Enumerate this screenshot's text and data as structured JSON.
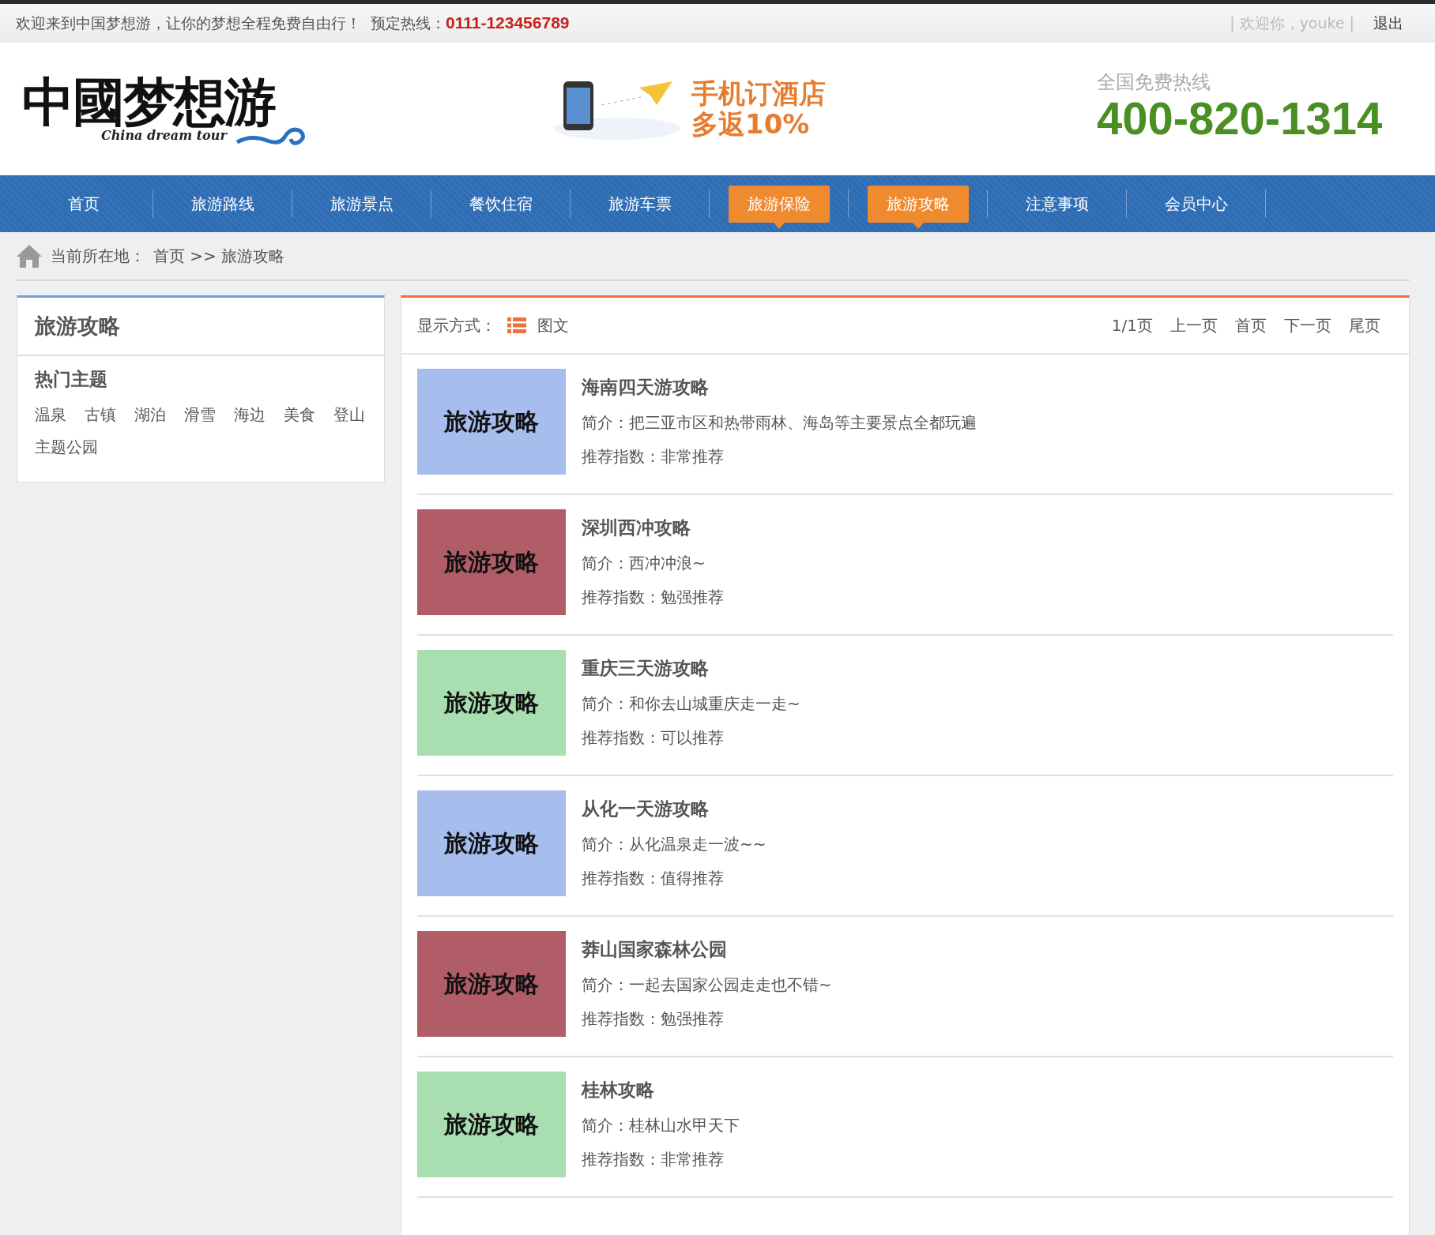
{
  "top_bar": {
    "welcome": "欢迎来到中国梦想游，让你的梦想全程免费自由行！",
    "hotline_label": "预定热线：",
    "hotline": "0111-123456789",
    "user_greeting": "| 欢迎你，youke |",
    "logout": "退出"
  },
  "header": {
    "logo_text": "中國梦想游",
    "logo_subtitle": "China dream tour",
    "promo_line_1": "手机订酒店",
    "promo_line_2": "多返10%",
    "phone_label": "全国免费热线",
    "phone": "400-820-1314"
  },
  "nav": [
    {
      "label": "首页",
      "selected": false
    },
    {
      "label": "旅游路线",
      "selected": false
    },
    {
      "label": "旅游景点",
      "selected": false
    },
    {
      "label": "餐饮住宿",
      "selected": false
    },
    {
      "label": "旅游车票",
      "selected": false
    },
    {
      "label": "旅游保险",
      "selected": true
    },
    {
      "label": "旅游攻略",
      "selected": true
    },
    {
      "label": "注意事项",
      "selected": false
    },
    {
      "label": "会员中心",
      "selected": false
    }
  ],
  "breadcrumb": {
    "label": "当前所在地：",
    "path": "首页 >> 旅游攻略"
  },
  "sidebar": {
    "title": "旅游攻略",
    "section_title": "热门主题",
    "tags": [
      "温泉",
      "古镇",
      "湖泊",
      "滑雪",
      "海边",
      "美食",
      "登山",
      "主题公园"
    ]
  },
  "toolbar": {
    "display_label": "显示方式：",
    "display_mode": "图文",
    "page_info": "1/1页",
    "pager": [
      "上一页",
      "首页",
      "下一页",
      "尾页"
    ]
  },
  "articles": [
    {
      "thumb_text": "旅游攻略",
      "color": "#a6bdee",
      "title": "海南四天游攻略",
      "summary": "简介：把三亚市区和热带雨林、海岛等主要景点全都玩遍",
      "rating": "推荐指数：非常推荐"
    },
    {
      "thumb_text": "旅游攻略",
      "color": "#b05d68",
      "title": "深圳西冲攻略",
      "summary": "简介：西冲冲浪~",
      "rating": "推荐指数：勉强推荐"
    },
    {
      "thumb_text": "旅游攻略",
      "color": "#a8deb0",
      "title": "重庆三天游攻略",
      "summary": "简介：和你去山城重庆走一走~",
      "rating": "推荐指数：可以推荐"
    },
    {
      "thumb_text": "旅游攻略",
      "color": "#a6bdee",
      "title": "从化一天游攻略",
      "summary": "简介：从化温泉走一波~~",
      "rating": "推荐指数：值得推荐"
    },
    {
      "thumb_text": "旅游攻略",
      "color": "#b05d68",
      "title": "莽山国家森林公园",
      "summary": "简介：一起去国家公园走走也不错~",
      "rating": "推荐指数：勉强推荐"
    },
    {
      "thumb_text": "旅游攻略",
      "color": "#a8deb0",
      "title": "桂林攻略",
      "summary": "简介：桂林山水甲天下",
      "rating": "推荐指数：非常推荐"
    }
  ]
}
